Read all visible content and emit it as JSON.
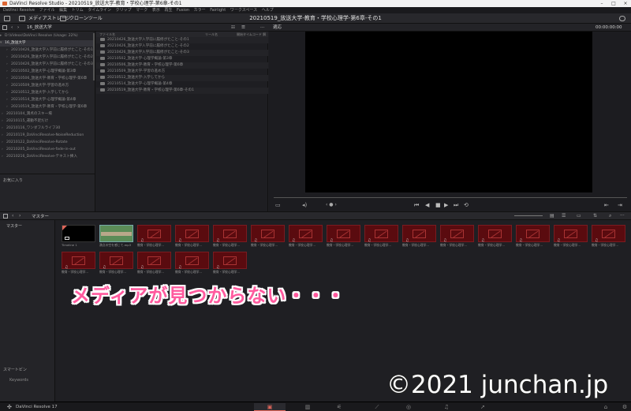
{
  "window": {
    "title": "DaVinci Resolve Studio - 20210519_放送大学-教育・学校心理学-第6章-その1"
  },
  "menu": [
    "DaVinci Resolve",
    "ファイル",
    "編集",
    "トリム",
    "タイムライン",
    "クリップ",
    "マーク",
    "表示",
    "再生",
    "Fusion",
    "カラー",
    "Fairlight",
    "ワークスペース",
    "ヘルプ"
  ],
  "toolbar": {
    "media_storage": "メディアストレージ",
    "clone_tool": "クローンツール",
    "project_title": "20210519_放送大学-教育・学校心理学-第6章-その1"
  },
  "library": {
    "current": "16_放送大学",
    "root": "D:\\Videos\\DaVinci Resolve (Usage: 22%)",
    "selected": "16_放送大学",
    "items": [
      "20210426_放送大学入学前に履修がたこと-その1",
      "20210426_放送大学入学前に履修がたこと-その2",
      "20210426_放送大学入学前に履修がたこと-その3",
      "20210502_放送大学-心理学概論-第3章",
      "20210506_放送大学-教育・学校心理学-第6章",
      "20210509_放送大学-学習の進め方",
      "20210512_放送大学-入学してから",
      "20210514_放送大学-心理学概論-第4章",
      "20210519_放送大学-教育・学校心理学-第6章",
      "20210104_満点のスキー場",
      "20210115_運動不足だけ",
      "20210116_ワンダフルライフ30",
      "20210119_DaVinciResolve-NoiseReduction",
      "20210122_DaVinciResolve-Rotate",
      "20210205_DaVinciResolve-fade-in-out",
      "20210216_DaVinciResolve-テキスト挿入"
    ],
    "favorites_label": "お気に入り"
  },
  "file_browser": {
    "col_name": "ファイル名",
    "col_reel": "リール名",
    "col_tc": "開始タイムコード 解像度",
    "rows": [
      "20210426_放送大学入学前に履修がたこと-その1",
      "20210426_放送大学入学前に履修がたこと-その2",
      "20210426_放送大学入学前に履修がたこと-その3",
      "20210502_放送大学-心理学概論-第3章",
      "20210506_放送大学-教育・学校心理学-第6章",
      "20210509_放送大学-学習の進め方",
      "20210512_放送大学-入学してから",
      "20210514_放送大学-心理学概論-第4章",
      "20210519_放送大学-教育・学校心理学-第6章-その1"
    ]
  },
  "viewer": {
    "zoom": "適応",
    "timecode": "00:00:00:00"
  },
  "media_pool": {
    "path": "マスター",
    "bin_master": "マスター",
    "smart_bins": "スマートビン",
    "keywords": "Keywords",
    "clips": [
      {
        "name": "Timeline 1",
        "kind": "timeline"
      },
      {
        "name": "満点の空を感じて.mp3",
        "kind": "audio"
      },
      {
        "name": "教育・学校心理学...",
        "kind": "missing"
      },
      {
        "name": "教育・学校心理学...",
        "kind": "missing"
      },
      {
        "name": "教育・学校心理学...",
        "kind": "missing"
      },
      {
        "name": "教育・学校心理学...",
        "kind": "missing"
      },
      {
        "name": "教育・学校心理学...",
        "kind": "missing"
      },
      {
        "name": "教育・学校心理学...",
        "kind": "missing"
      },
      {
        "name": "教育・学校心理学...",
        "kind": "missing"
      },
      {
        "name": "教育・学校心理学...",
        "kind": "missing"
      },
      {
        "name": "教育・学校心理学...",
        "kind": "missing"
      },
      {
        "name": "教育・学校心理学...",
        "kind": "missing"
      },
      {
        "name": "教育・学校心理学...",
        "kind": "missing"
      },
      {
        "name": "教育・学校心理学...",
        "kind": "missing"
      },
      {
        "name": "教育・学校心理学...",
        "kind": "missing"
      },
      {
        "name": "教育・学校心理学...",
        "kind": "missing"
      },
      {
        "name": "教育・学校心理学...",
        "kind": "missing"
      },
      {
        "name": "教育・学校心理学...",
        "kind": "missing"
      },
      {
        "name": "教育・学校心理学...",
        "kind": "missing"
      },
      {
        "name": "教育・学校心理学...",
        "kind": "missing"
      }
    ]
  },
  "annotation": "メディアが見つからない・・・",
  "watermark": "©2021 junchan.jp",
  "footer": {
    "app_name": "DaVinci Resolve 17"
  },
  "colors": {
    "accent": "#e0665a",
    "missing_clip": "#5a0b0f",
    "annotation": "#ff5a9e"
  }
}
